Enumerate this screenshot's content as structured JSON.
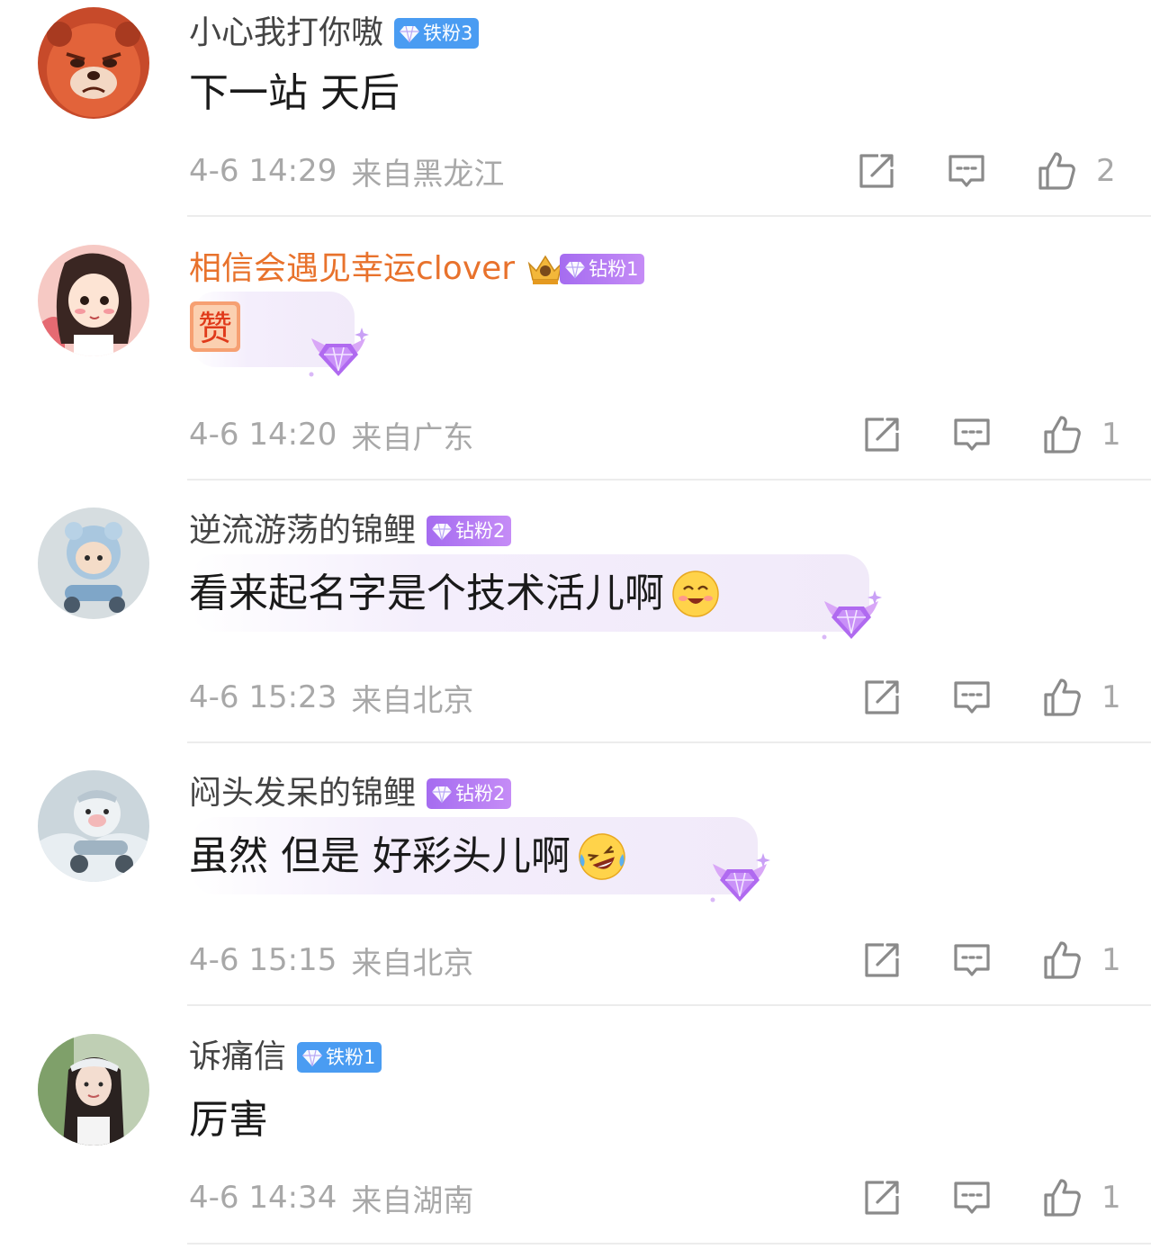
{
  "comments": [
    {
      "username": "小心我打你嗷",
      "badge": "铁粉3",
      "text": "下一站 天后",
      "time": "4-6 14:29",
      "location": "来自黑龙江",
      "likes": "2"
    },
    {
      "username": "相信会遇见幸运clover",
      "badge": "钻粉1",
      "sticker": "赞",
      "time": "4-6 14:20",
      "location": "来自广东",
      "likes": "1"
    },
    {
      "username": "逆流游荡的锦鲤",
      "badge": "钻粉2",
      "text": "看来起名字是个技术活儿啊",
      "emoji": "smiling-face-icon",
      "time": "4-6 15:23",
      "location": "来自北京",
      "likes": "1"
    },
    {
      "username": "闷头发呆的锦鲤",
      "badge": "钻粉2",
      "text": "虽然 但是 好彩头儿啊",
      "emoji": "laughing-crying-face-icon",
      "time": "4-6 15:15",
      "location": "来自北京",
      "likes": "1"
    },
    {
      "username": "诉痛信",
      "badge": "铁粉1",
      "text": "厉害",
      "time": "4-6 14:34",
      "location": "来自湖南",
      "likes": "1"
    }
  ],
  "icons": {
    "share": "share-icon",
    "reply": "comment-icon",
    "like": "thumbs-up-icon"
  },
  "colors": {
    "vip_username": "#e8722c",
    "iron_badge": "#4a9cf2",
    "diamond_badge": "#b47cf3",
    "meta_text": "#a8a8a8"
  }
}
